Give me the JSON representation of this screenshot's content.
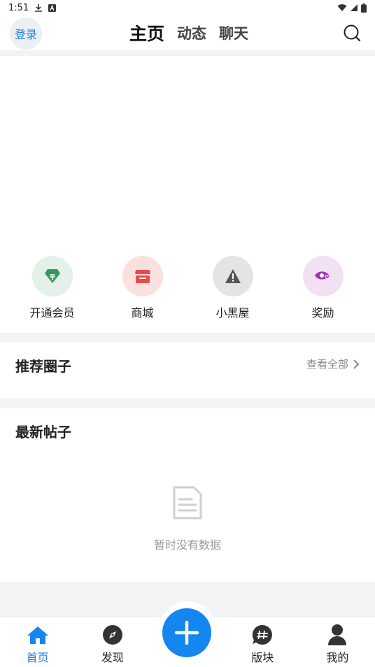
{
  "status": {
    "time": "1:51"
  },
  "header": {
    "login": "登录",
    "tabs": [
      {
        "label": "主页",
        "active": true
      },
      {
        "label": "动态",
        "active": false
      },
      {
        "label": "聊天",
        "active": false
      }
    ]
  },
  "quick": [
    {
      "label": "开通会员",
      "icon": "diamond-icon",
      "bg": "#e3f1e8",
      "color": "#2f9a5c"
    },
    {
      "label": "商城",
      "icon": "store-icon",
      "bg": "#fbe0e0",
      "color": "#ea4b4b"
    },
    {
      "label": "小黑屋",
      "icon": "warning-icon",
      "bg": "#e4e4e6",
      "color": "#555555"
    },
    {
      "label": "奖励",
      "icon": "eye-heart-icon",
      "bg": "#f1e1f3",
      "color": "#9b36b6"
    }
  ],
  "recommend": {
    "title": "推荐圈子",
    "view_all": "查看全部"
  },
  "latest": {
    "title": "最新帖子",
    "empty": "暂时没有数据"
  },
  "tabbar": {
    "items": [
      {
        "label": "首页",
        "icon": "home-icon",
        "active": true
      },
      {
        "label": "发现",
        "icon": "compass-icon",
        "active": false
      },
      {
        "label": "版块",
        "icon": "hashtag-chat-icon",
        "active": false
      },
      {
        "label": "我的",
        "icon": "person-icon",
        "active": false
      }
    ]
  },
  "accent": "#1486f0"
}
